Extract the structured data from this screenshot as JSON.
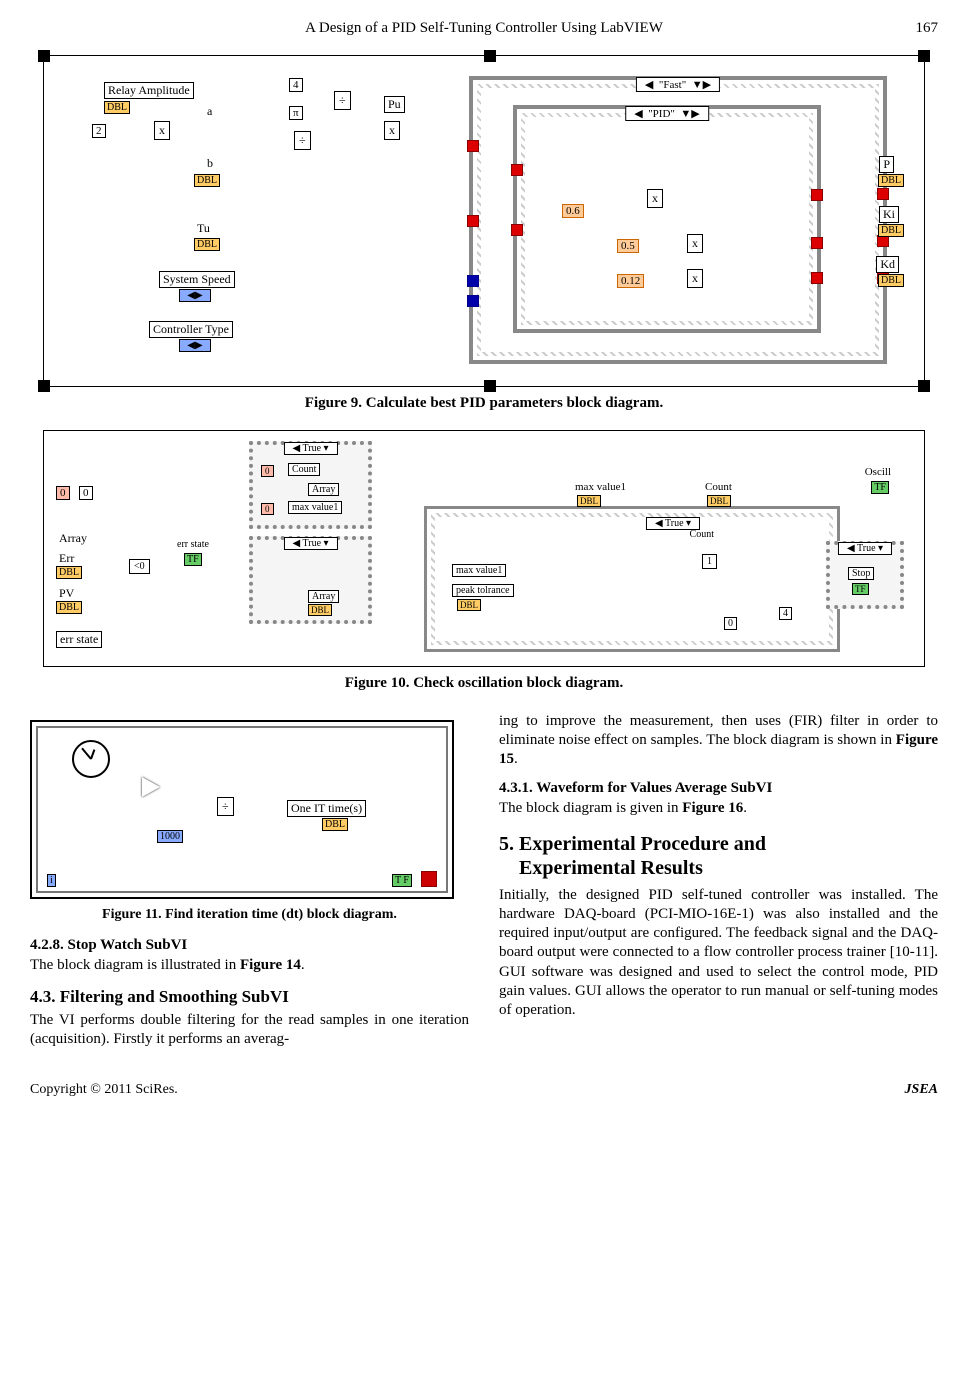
{
  "header": {
    "title": "A Design of a PID Self-Tuning Controller Using LabVIEW",
    "page": "167"
  },
  "fig9": {
    "caption": "Figure 9. Calculate best PID parameters block diagram.",
    "labels": {
      "relayAmp": "Relay Amplitude",
      "two": "2",
      "four": "4",
      "pi": "π",
      "a": "a",
      "b": "b",
      "pu": "Pu",
      "tu": "Tu",
      "sysSpeed": "System Speed",
      "ctrlType": "Controller Type",
      "fast": "\"Fast\"",
      "pid": "\"PID\"",
      "k06": "0.6",
      "k05": "0.5",
      "k012": "0.12",
      "p": "P",
      "ki": "Ki",
      "kd": "Kd",
      "dbl": "DBL",
      "div": "÷",
      "mul": "x"
    }
  },
  "fig10": {
    "caption": "Figure 10. Check oscillation block diagram.",
    "labels": {
      "zero": "0",
      "count": "Count",
      "array": "Array",
      "maxVal": "max value1",
      "err": "Err",
      "pv": "PV",
      "errState": "err state",
      "true": "True ▾",
      "peakTol": "peak tolrance",
      "oscill": "Oscill",
      "stop": "Stop",
      "dbl": "DBL",
      "tf": "TF",
      "one": "1",
      "four": "4",
      "lt0": "<0"
    }
  },
  "fig11": {
    "caption": "Figure 11. Find iteration time (dt) block diagram.",
    "labels": {
      "thousand": "1000",
      "oneIT": "One IT time(s)",
      "dbl": "DBL",
      "tf": "T F",
      "i": "i",
      "div": "÷"
    }
  },
  "leftCol": {
    "s428_head": "4.2.8. Stop Watch SubVI",
    "s428_body": "The block diagram is illustrated in Figure 14.",
    "s43_head": "4.3. Filtering and Smoothing SubVI",
    "s43_body": "The VI performs double filtering for the read samples in one iteration (acquisition). Firstly it performs an averag-"
  },
  "rightCol": {
    "cont1": "ing to improve the measurement, then uses (FIR) filter in order to eliminate noise effect on samples. The block diagram is shown in Figure 15.",
    "s431_head": "4.3.1. Waveform for Values Average SubVI",
    "s431_body": "The block diagram is given in Figure 16.",
    "s5_head": "5. Experimental Procedure and Experimental Results",
    "s5_body": "Initially, the designed PID self-tuned controller was installed. The hardware DAQ-board (PCI-MIO-16E-1) was also installed and the required input/output are configured. The feedback signal and the DAQ-board output were connected to a flow controller process trainer [10-11]. GUI software was designed and used to select the control mode, PID gain values. GUI allows the operator to run manual or self-tuning modes of operation."
  },
  "footer": {
    "left": "Copyright © 2011 SciRes.",
    "right": "JSEA"
  }
}
